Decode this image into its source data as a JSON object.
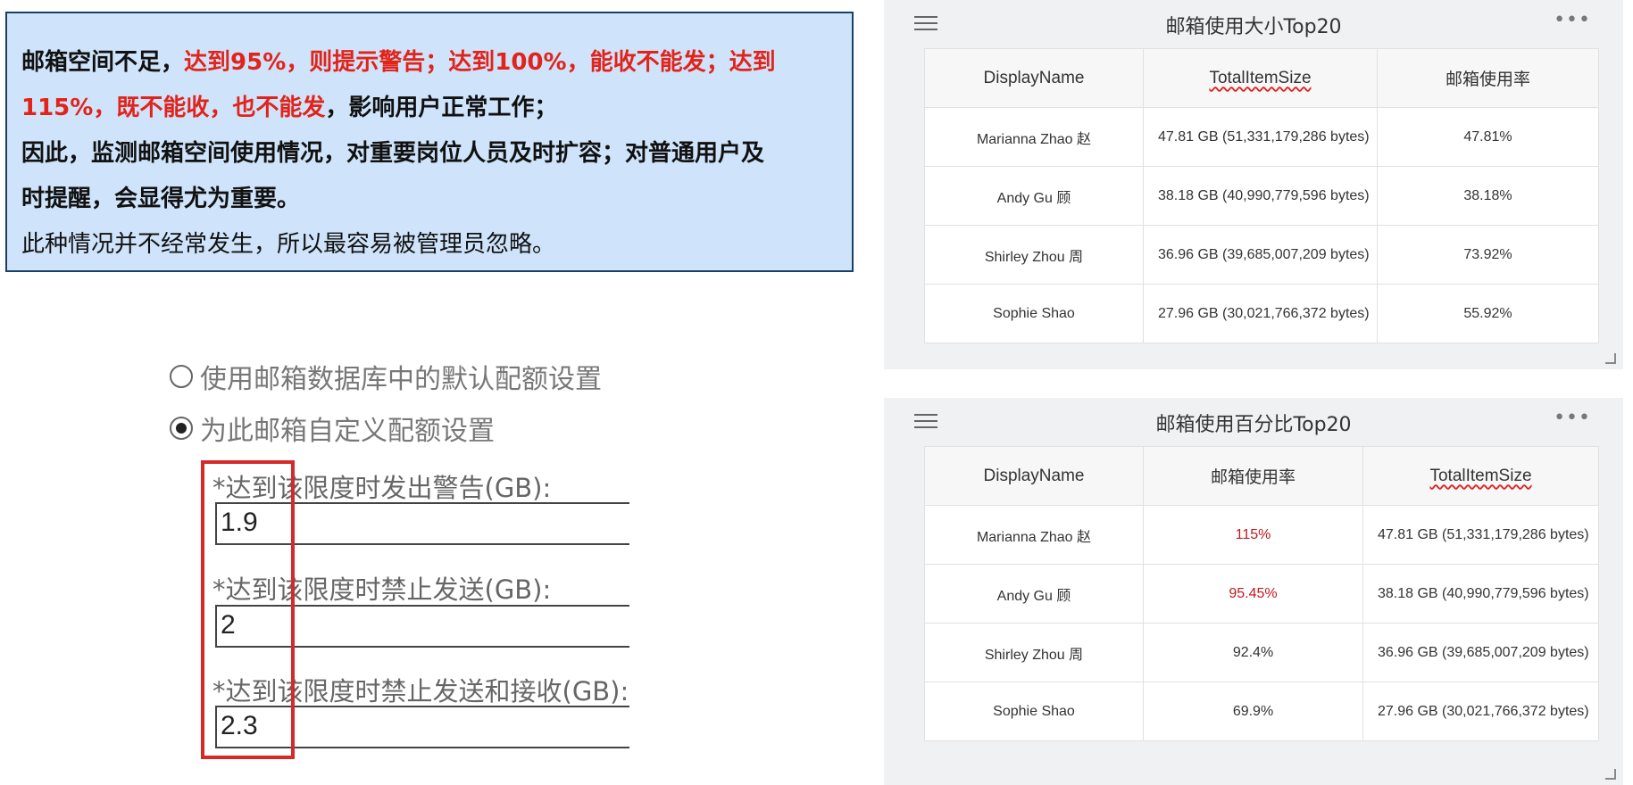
{
  "callout": {
    "line1_a": "邮箱空间不足，",
    "line1_b": "达到95%，则提示警告；达到100%，能收不能发；达到",
    "line2_a": "115%，既不能收，也不能发",
    "line2_b": "，影响用户正常工作；",
    "line3": "因此，监测邮箱空间使用情况，对重要岗位人员及时扩容；对普通用户及",
    "line4": "时提醒，会显得尤为重要。",
    "line5": "此种情况并不经常发生，所以最容易被管理员忽略。",
    "accent_color": "#e2231a",
    "bg_color": "#cfe4fb"
  },
  "quota": {
    "option_default": "使用邮箱数据库中的默认配额设置",
    "option_custom": "为此邮箱自定义配额设置",
    "warn_label": "*达到该限度时发出警告(GB):",
    "warn_value": "1.9",
    "send_label": "*达到该限度时禁止发送(GB):",
    "send_value": "2",
    "sendrecv_label": "*达到该限度时禁止发送和接收(GB):",
    "sendrecv_value": "2.3"
  },
  "panel1": {
    "title": "邮箱使用大小Top20",
    "menu_icon": "hamburger-icon",
    "more_icon": "more-dots-icon",
    "columns": [
      "DisplayName",
      "TotalItemSize",
      "邮箱使用率"
    ],
    "rows": [
      {
        "name": "Marianna Zhao 赵",
        "size": "47.81 GB (51,331,179,286 bytes)",
        "rate": "47.81%"
      },
      {
        "name": "Andy Gu 顾",
        "size": "38.18 GB (40,990,779,596 bytes)",
        "rate": "38.18%"
      },
      {
        "name": "Shirley Zhou 周",
        "size": "36.96 GB (39,685,007,209 bytes)",
        "rate": "73.92%"
      },
      {
        "name": "Sophie Shao",
        "size": "27.96 GB (30,021,766,372 bytes)",
        "rate": "55.92%"
      }
    ]
  },
  "panel2": {
    "title": "邮箱使用百分比Top20",
    "columns": [
      "DisplayName",
      "邮箱使用率",
      "TotalItemSize"
    ],
    "rows": [
      {
        "name": "Marianna Zhao 赵",
        "rate": "115%",
        "size": "47.81 GB (51,331,179,286 bytes)"
      },
      {
        "name": "Andy Gu 顾",
        "rate": "95.45%",
        "size": "38.18 GB (40,990,779,596 bytes)"
      },
      {
        "name": "Shirley Zhou 周",
        "rate": "92.4%",
        "size": "36.96 GB (39,685,007,209 bytes)"
      },
      {
        "name": "Sophie Shao",
        "rate": "69.9%",
        "size": "27.96 GB (30,021,766,372 bytes)"
      }
    ],
    "highlight_color": "#c0191e"
  }
}
